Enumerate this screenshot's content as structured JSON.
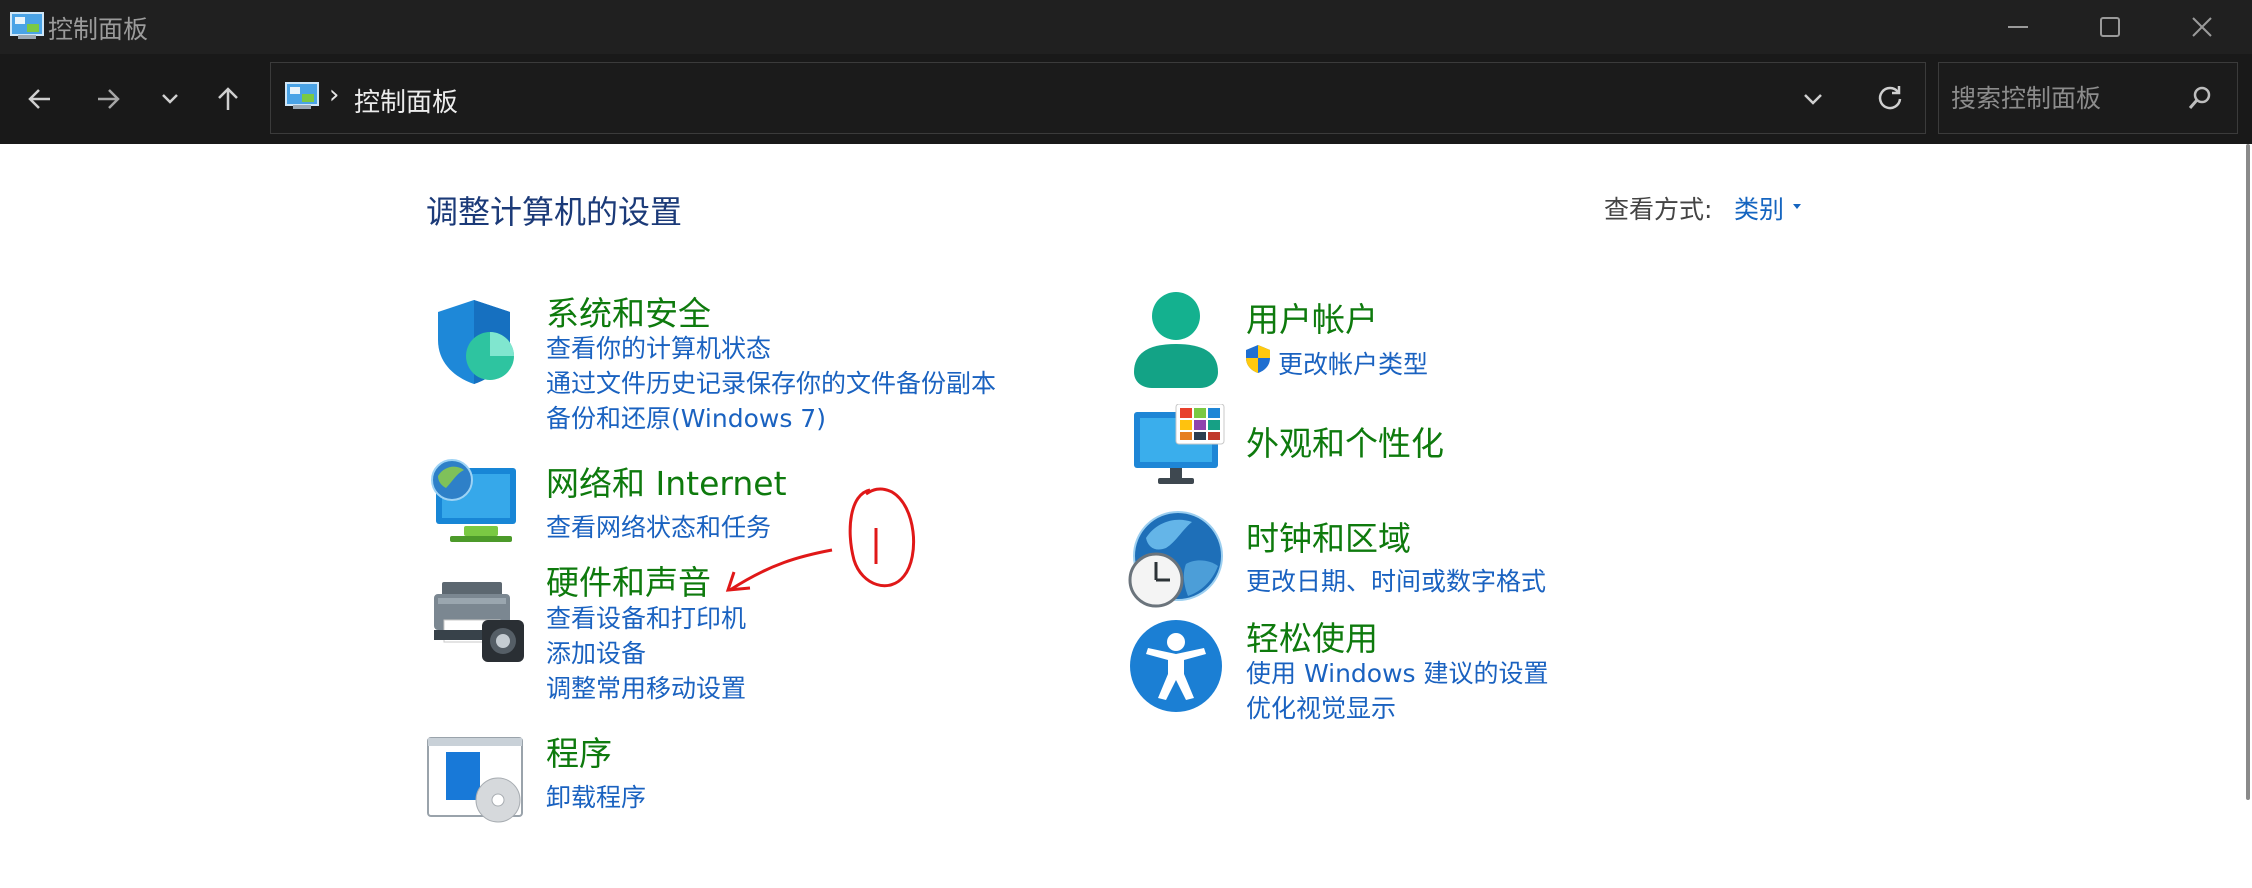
{
  "window": {
    "title": "控制面板",
    "minimize_icon": "minimize-icon",
    "maximize_icon": "maximize-icon",
    "close_icon": "close-icon"
  },
  "navbar": {
    "back_icon": "arrow-left-icon",
    "forward_icon": "arrow-right-icon",
    "recent_icon": "chevron-down-icon",
    "up_icon": "arrow-up-icon",
    "address": {
      "separator": "›",
      "path": "控制面板"
    },
    "search": {
      "placeholder": "搜索控制面板"
    }
  },
  "content": {
    "heading": "调整计算机的设置",
    "view_by": {
      "label": "查看方式:",
      "value": "类别"
    },
    "left_categories": [
      {
        "title": "系统和安全",
        "icon": "shield-icon",
        "links": [
          "查看你的计算机状态",
          "通过文件历史记录保存你的文件备份副本",
          "备份和还原(Windows 7)"
        ]
      },
      {
        "title": "网络和 Internet",
        "icon": "network-globe-icon",
        "links": [
          "查看网络状态和任务"
        ]
      },
      {
        "title": "硬件和声音",
        "icon": "printer-icon",
        "links": [
          "查看设备和打印机",
          "添加设备",
          "调整常用移动设置"
        ]
      },
      {
        "title": "程序",
        "icon": "programs-disc-icon",
        "links": [
          "卸载程序"
        ]
      }
    ],
    "right_categories": [
      {
        "title": "用户帐户",
        "icon": "user-icon",
        "links": [
          "更改帐户类型"
        ],
        "link_icon": "uac-shield-icon"
      },
      {
        "title": "外观和个性化",
        "icon": "monitor-palette-icon",
        "links": []
      },
      {
        "title": "时钟和区域",
        "icon": "globe-clock-icon",
        "links": [
          "更改日期、时间或数字格式"
        ]
      },
      {
        "title": "轻松使用",
        "icon": "accessibility-icon",
        "links": [
          "使用 Windows 建议的设置",
          "优化视觉显示"
        ]
      }
    ]
  },
  "colors": {
    "titlebar_bg": "#202020",
    "navbar_bg": "#191919",
    "category_title": "#0e7a0d",
    "link": "#1a62c0",
    "heading": "#1b3a78",
    "annotation": "#e01818"
  }
}
